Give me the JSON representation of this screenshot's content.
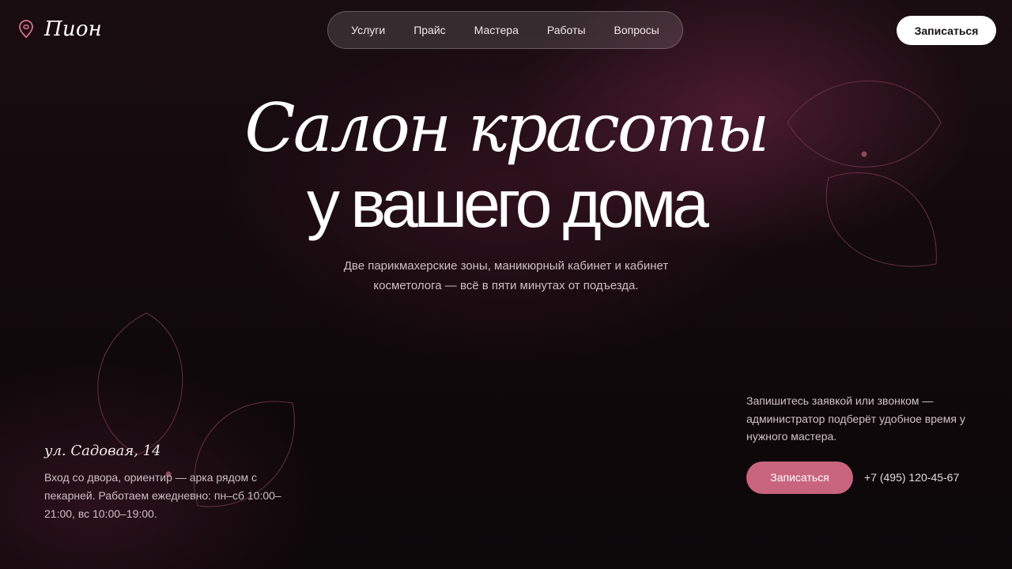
{
  "brand": {
    "name": "Пион",
    "icon": "peony-pin-icon",
    "accent": "#c9647f"
  },
  "nav": {
    "items": [
      {
        "label": "Услуги"
      },
      {
        "label": "Прайс"
      },
      {
        "label": "Мастера"
      },
      {
        "label": "Работы"
      },
      {
        "label": "Вопросы"
      }
    ]
  },
  "header": {
    "cta_label": "Записаться"
  },
  "hero": {
    "title_line_1": "Салон красоты",
    "title_line_2": "у вашего дома",
    "subtitle": "Две парикмахерские зоны, маникюрный кабинет и кабинет косметолога — всё в пяти минутах от подъезда."
  },
  "address": {
    "title": "ул. Садовая, 14",
    "text": "Вход со двора, ориентир — арка рядом с пекарней. Работаем ежедневно: пн–сб 10:00–21:00, вс 10:00–19:00."
  },
  "booking": {
    "text": "Запишитесь заявкой или звонком — администратор подберёт удобное время у нужного мастера.",
    "button_label": "Записаться",
    "phone": "+7 (495) 120-45-67"
  },
  "colors": {
    "background": "#0b0708",
    "accent": "#c9647f",
    "button_light": "#ffffff"
  }
}
